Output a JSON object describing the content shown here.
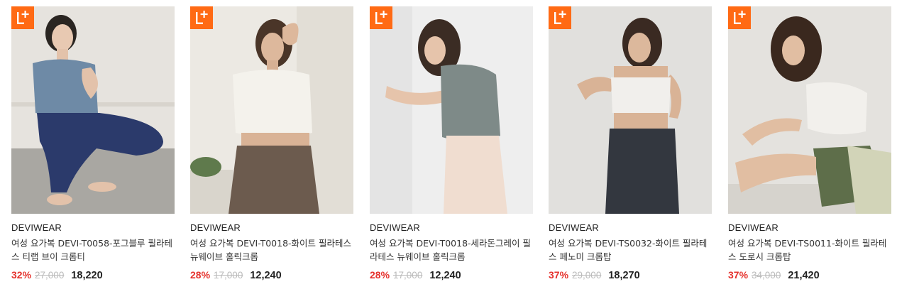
{
  "badge": {
    "icon": "lplus-badge-icon",
    "color": "#ff6a14"
  },
  "colors": {
    "discount": "#e5322d",
    "original_price": "#bbbbbb",
    "sale_price": "#222222"
  },
  "products": [
    {
      "brand": "DEVIWEAR",
      "name": "여성 요가복 DEVI-T0058-포그블루 필라테스 티랩 브이 크롭티",
      "discount": "32%",
      "original_price": "27,000",
      "sale_price": "18,220",
      "image": "woman-seated-blue-wrap-top"
    },
    {
      "brand": "DEVIWEAR",
      "name": "여성 요가복 DEVI-T0018-화이트 필라테스 뉴웨이브 홀릭크롭",
      "discount": "28%",
      "original_price": "17,000",
      "sale_price": "12,240",
      "image": "woman-white-crop-top"
    },
    {
      "brand": "DEVIWEAR",
      "name": "여성 요가복 DEVI-T0018-세라돈그레이 필라테스 뉴웨이브 홀릭크롭",
      "discount": "28%",
      "original_price": "17,000",
      "sale_price": "12,240",
      "image": "woman-grey-crop-top"
    },
    {
      "brand": "DEVIWEAR",
      "name": "여성 요가복 DEVI-TS0032-화이트 필라테스 페노미 크롭탑",
      "discount": "37%",
      "original_price": "29,000",
      "sale_price": "18,270",
      "image": "woman-white-bra-top"
    },
    {
      "brand": "DEVIWEAR",
      "name": "여성 요가복 DEVI-TS0011-화이트 필라테스 도로시 크롭탑",
      "discount": "37%",
      "original_price": "34,000",
      "sale_price": "21,420",
      "image": "woman-seated-white-crop-top"
    }
  ]
}
